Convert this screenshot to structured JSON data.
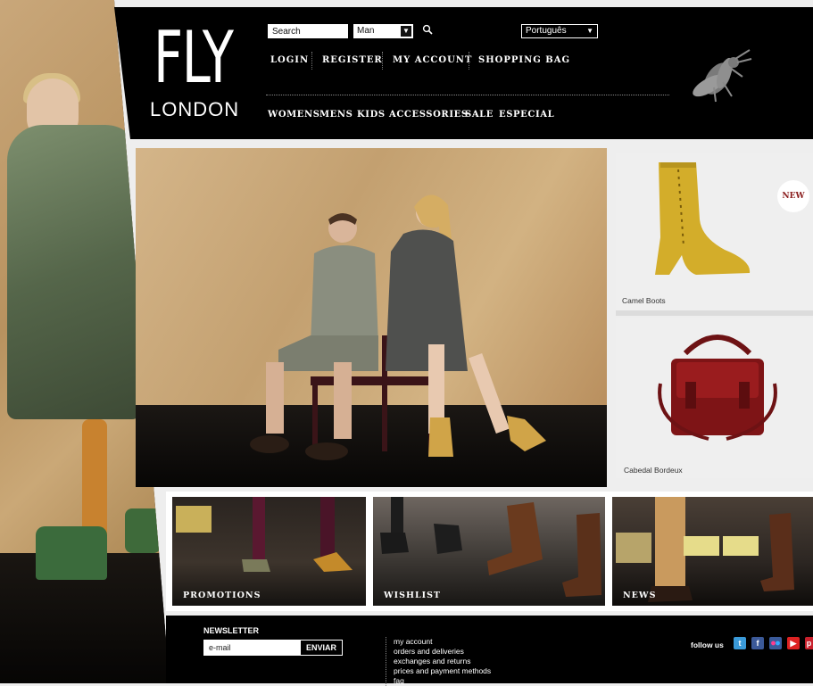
{
  "brand": {
    "logo_top": "FLY",
    "logo_bottom": "LONDON"
  },
  "search": {
    "placeholder": "Search",
    "gender_value": "Man",
    "language_value": "Português"
  },
  "top_nav": [
    "LOGIN",
    "REGISTER",
    "MY ACCOUNT",
    "SHOPPING BAG"
  ],
  "category_nav": [
    "WOMENS",
    "MENS",
    "KIDS",
    "ACCESSORIES",
    "SALE",
    "ESPECIAL"
  ],
  "products": [
    {
      "name": "Camel Boots",
      "badge": "NEW"
    },
    {
      "name": "Cabedal Bordeux"
    }
  ],
  "promos": [
    "PROMOTIONS",
    "WISHLIST",
    "NEWS"
  ],
  "newsletter": {
    "title": "NEWSLETTER",
    "email_placeholder": "e-mail",
    "button": "ENVIAR"
  },
  "footer_links": [
    "my account",
    "orders and deliveries",
    "exchanges and returns",
    "prices and payment methods",
    "faq"
  ],
  "social": {
    "label": "follow us",
    "icons": [
      "twitter-icon",
      "facebook-icon",
      "flickr-icon",
      "youtube-icon",
      "pinterest-icon"
    ]
  },
  "colors": {
    "header_bg": "#000000",
    "page_bg": "#eeeeee",
    "badge_text": "#8a1c1c"
  }
}
